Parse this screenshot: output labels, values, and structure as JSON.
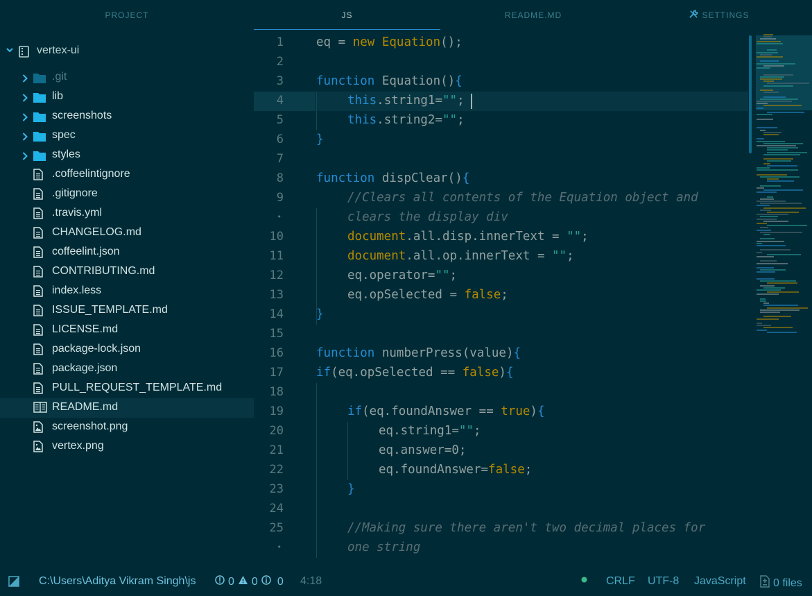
{
  "tabs": [
    {
      "label": "PROJECT",
      "active": false
    },
    {
      "label": "JS",
      "active": true
    },
    {
      "label": "README.MD",
      "active": false
    },
    {
      "label": "SETTINGS",
      "active": false,
      "icon": "tools-icon"
    }
  ],
  "tree": {
    "root": "vertex-ui",
    "items": [
      {
        "label": ".git",
        "type": "folder",
        "dim": true
      },
      {
        "label": "lib",
        "type": "folder"
      },
      {
        "label": "screenshots",
        "type": "folder"
      },
      {
        "label": "spec",
        "type": "folder"
      },
      {
        "label": "styles",
        "type": "folder"
      },
      {
        "label": ".coffeelintignore",
        "type": "file"
      },
      {
        "label": ".gitignore",
        "type": "file"
      },
      {
        "label": ".travis.yml",
        "type": "file"
      },
      {
        "label": "CHANGELOG.md",
        "type": "file"
      },
      {
        "label": "coffeelint.json",
        "type": "file"
      },
      {
        "label": "CONTRIBUTING.md",
        "type": "file"
      },
      {
        "label": "index.less",
        "type": "file"
      },
      {
        "label": "ISSUE_TEMPLATE.md",
        "type": "file"
      },
      {
        "label": "LICENSE.md",
        "type": "file"
      },
      {
        "label": "package-lock.json",
        "type": "file"
      },
      {
        "label": "package.json",
        "type": "file"
      },
      {
        "label": "PULL_REQUEST_TEMPLATE.md",
        "type": "file"
      },
      {
        "label": "README.md",
        "type": "book",
        "selected": true
      },
      {
        "label": "screenshot.png",
        "type": "image"
      },
      {
        "label": "vertex.png",
        "type": "image"
      }
    ]
  },
  "editor": {
    "line_numbers": [
      "1",
      "2",
      "3",
      "4",
      "5",
      "6",
      "7",
      "8",
      "9",
      "•",
      "10",
      "11",
      "12",
      "13",
      "14",
      "15",
      "16",
      "17",
      "18",
      "19",
      "20",
      "21",
      "22",
      "23",
      "24",
      "25",
      "•"
    ],
    "code": {
      "l1_a": "eq = ",
      "l1_new": "new",
      "l1_cls": " Equation",
      "l1_b": "();",
      "l3_kw": "function",
      "l3_fn": " Equation()",
      "l3_br": "{",
      "l4_this": "this",
      "l4_a": ".string1=",
      "l4_s": "\"\"",
      "l4_b": ";",
      "l5_this": "this",
      "l5_a": ".string2=",
      "l5_s": "\"\"",
      "l5_b": ";",
      "l6": "}",
      "l8_kw": "function",
      "l8_fn": " dispClear()",
      "l8_br": "{",
      "l9_cm": "//Clears all contents of the Equation object and",
      "l9b_cm": "clears the display div",
      "l10_doc": "document",
      "l10_a": ".all.disp.innerText = ",
      "l10_s": "\"\"",
      "l10_b": ";",
      "l11_doc": "document",
      "l11_a": ".all.op.innerText = ",
      "l11_s": "\"\"",
      "l11_b": ";",
      "l12_a": "eq.operator=",
      "l12_s": "\"\"",
      "l12_b": ";",
      "l13_a": "eq.opSelected = ",
      "l13_bool": "false",
      "l13_b": ";",
      "l14": "}",
      "l16_kw": "function",
      "l16_fn": " numberPress(value)",
      "l16_br": "{",
      "l17_kw": "if",
      "l17_a": "(eq.opSelected == ",
      "l17_bool": "false",
      "l17_b": ")",
      "l17_br": "{",
      "l19_kw": "if",
      "l19_a": "(eq.foundAnswer == ",
      "l19_bool": "true",
      "l19_b": ")",
      "l19_br": "{",
      "l20_a": "eq.string1=",
      "l20_s": "\"\"",
      "l20_b": ";",
      "l21_a": "eq.answer=",
      "l21_n": "0",
      "l21_b": ";",
      "l22_a": "eq.foundAnswer=",
      "l22_bool": "false",
      "l22_b": ";",
      "l23": "}",
      "l25_cm": "//Making sure there aren't two decimal places for",
      "l25b_cm": "one string"
    }
  },
  "status": {
    "path": "C:\\Users\\Aditya Vikram Singh\\js",
    "errors": "0",
    "warnings": "0",
    "infos": "0",
    "cursor": "4:18",
    "line_ending": "CRLF",
    "encoding": "UTF-8",
    "grammar": "JavaScript",
    "files": "0 files"
  },
  "colors": {
    "background": "#002b36",
    "accent": "#268bd2",
    "selection": "#073642",
    "git_dot": "#3bb98b"
  }
}
